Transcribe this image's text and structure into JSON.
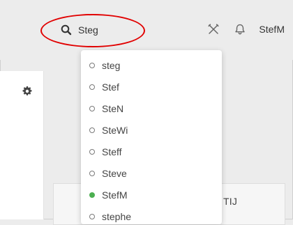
{
  "search": {
    "value": "Steg",
    "placeholder": ""
  },
  "header": {
    "user_name": "StefM"
  },
  "background": {
    "card_label": "TIJ"
  },
  "dropdown": {
    "items": [
      {
        "label": "steg",
        "status": "offline"
      },
      {
        "label": "Stef",
        "status": "offline"
      },
      {
        "label": "SteN",
        "status": "offline"
      },
      {
        "label": "SteWi",
        "status": "offline"
      },
      {
        "label": "Steff",
        "status": "offline"
      },
      {
        "label": "Steve",
        "status": "offline"
      },
      {
        "label": "StefM",
        "status": "online"
      },
      {
        "label": "stephe",
        "status": "offline"
      }
    ]
  },
  "icons": {
    "search": "search-icon",
    "tools": "tools-icon",
    "notifications": "bell-icon",
    "settings": "gear-icon"
  },
  "colors": {
    "highlight": "#e10000",
    "online": "#4caf50",
    "offline": "#7a7a7a"
  }
}
